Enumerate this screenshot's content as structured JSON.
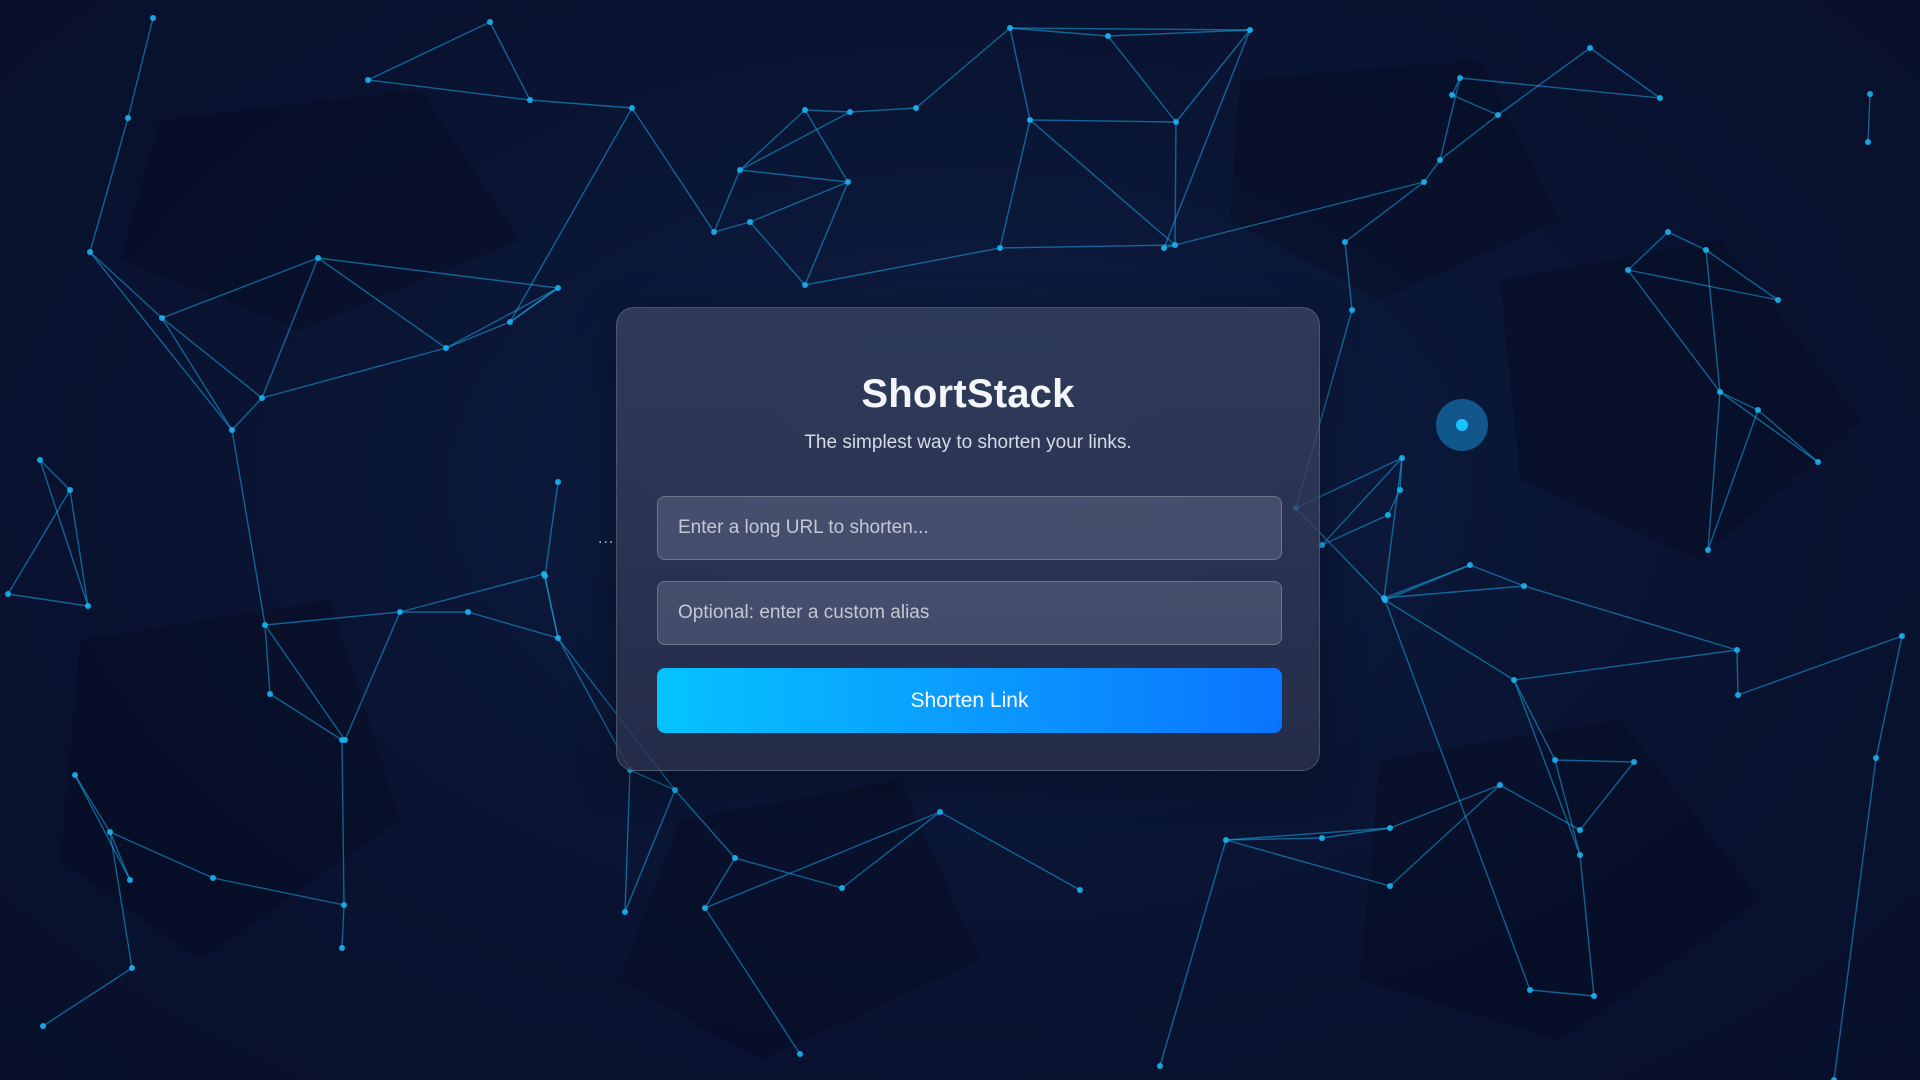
{
  "app": {
    "title": "ShortStack",
    "subtitle": "The simplest way to shorten your links."
  },
  "form": {
    "url_placeholder": "Enter a long URL to shorten...",
    "url_value": "",
    "alias_placeholder": "Optional: enter a custom alias",
    "alias_value": "",
    "submit_label": "Shorten Link"
  },
  "background": {
    "marker": "..."
  },
  "colors": {
    "background": "#0a1534",
    "network_line": "#1aa6e8",
    "network_node": "#1bb4f2",
    "button_start": "#05c3ff",
    "button_end": "#0a74ff"
  },
  "icons": {
    "cursor": "cursor-dot-icon"
  }
}
